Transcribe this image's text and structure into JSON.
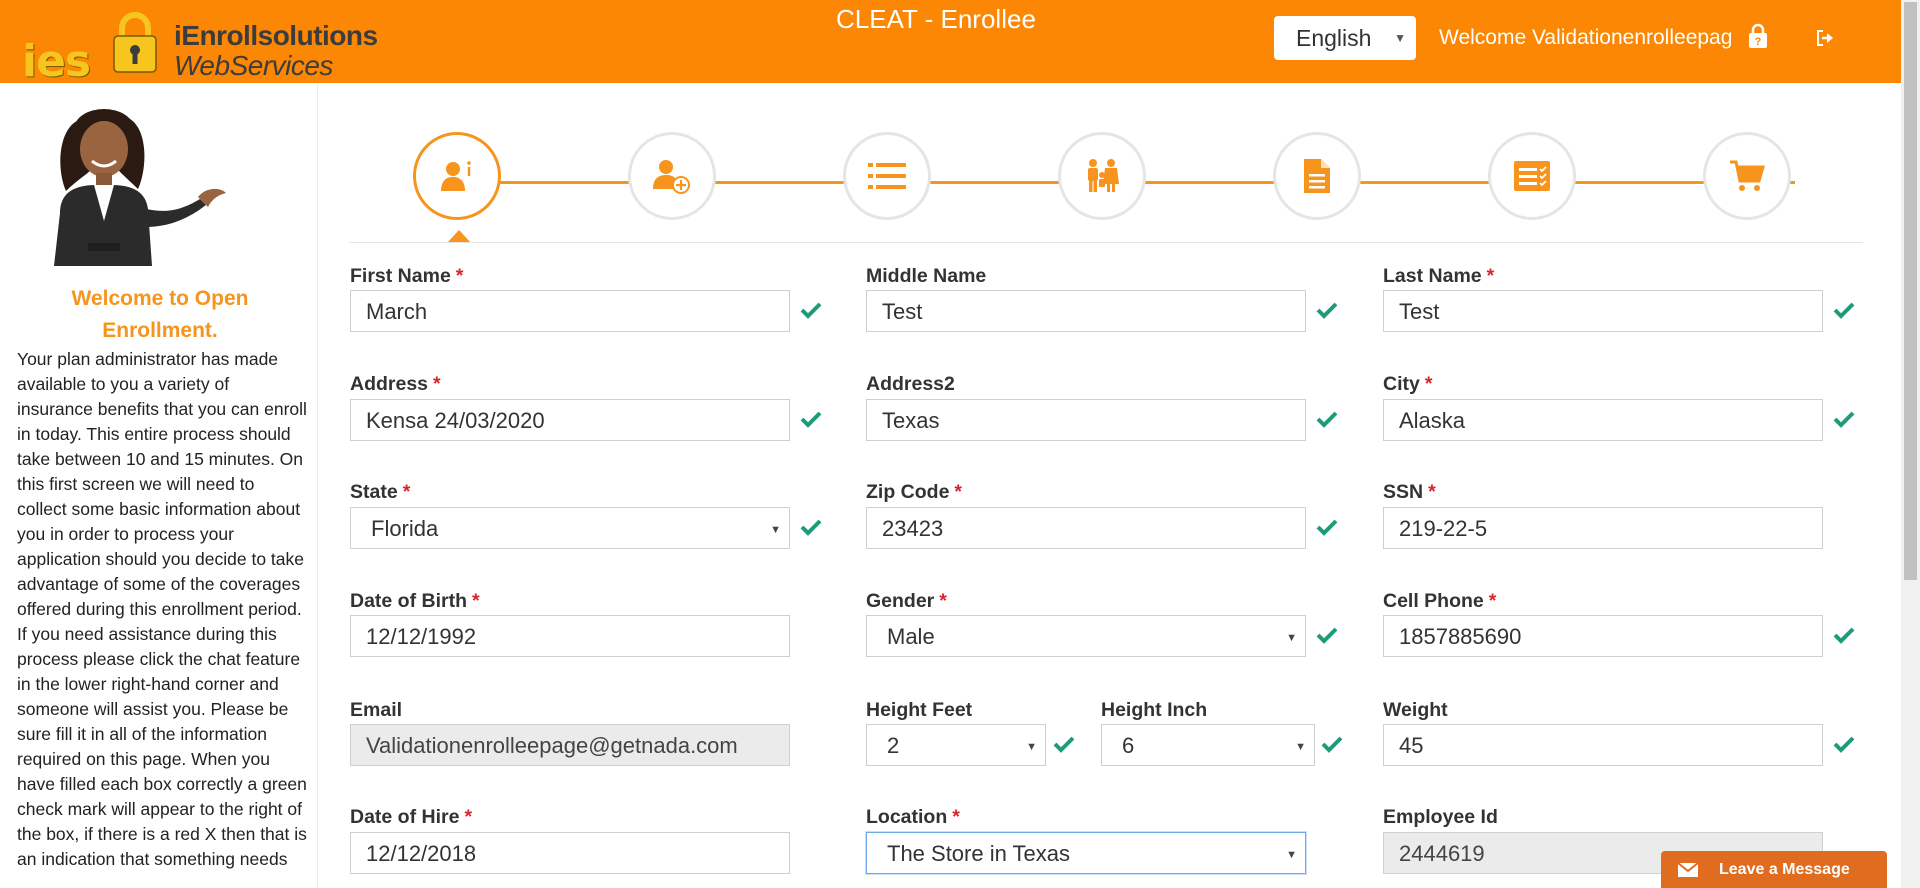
{
  "header": {
    "logo_abbrev": "ies",
    "logo_line1": "iEnrollsolutions",
    "logo_line2": "WebServices",
    "title": "CLEAT - Enrollee",
    "language": "English",
    "welcome": "Welcome Validationenrolleepag"
  },
  "sidebar": {
    "heading": "Welcome to Open Enrollment.",
    "body": "Your plan administrator has made available to you a variety of insurance benefits that you can enroll in today. This entire process should take between 10 and 15 minutes. On this first screen we will need to collect some basic information about you in order to process your application should you decide to take advantage of some of the coverages offered during this enrollment period.  If you need assistance during this process please click the chat feature in the lower right-hand corner and someone will assist you. Please be sure fill it in all of the information required on this page.  When you have filled each box correctly a green check mark will appear to the right of the box, if there is a red X then that is an indication that something needs"
  },
  "steps": [
    {
      "icon": "personal-info-icon",
      "active": true
    },
    {
      "icon": "add-dependent-icon",
      "active": false
    },
    {
      "icon": "list-icon",
      "active": false
    },
    {
      "icon": "family-icon",
      "active": false
    },
    {
      "icon": "document-icon",
      "active": false
    },
    {
      "icon": "checklist-icon",
      "active": false
    },
    {
      "icon": "cart-icon",
      "active": false
    }
  ],
  "form": {
    "first_name": {
      "label": "First Name",
      "value": "March"
    },
    "middle_name": {
      "label": "Middle Name",
      "value": "Test"
    },
    "last_name": {
      "label": "Last Name",
      "value": "Test"
    },
    "address": {
      "label": "Address",
      "value": "Kensa 24/03/2020"
    },
    "address2": {
      "label": "Address2",
      "value": "Texas"
    },
    "city": {
      "label": "City",
      "value": "Alaska"
    },
    "state": {
      "label": "State",
      "value": "Florida"
    },
    "zip": {
      "label": "Zip Code",
      "value": "23423"
    },
    "ssn": {
      "label": "SSN",
      "value": "219-22-5"
    },
    "dob": {
      "label": "Date of Birth",
      "value": "12/12/1992"
    },
    "gender": {
      "label": "Gender",
      "value": "Male"
    },
    "cell": {
      "label": "Cell Phone",
      "value": "1857885690"
    },
    "email": {
      "label": "Email",
      "value": "Validationenrolleepage@getnada.com"
    },
    "height_feet": {
      "label": "Height Feet",
      "value": "2"
    },
    "height_inch": {
      "label": "Height Inch",
      "value": "6"
    },
    "weight": {
      "label": "Weight",
      "value": "45"
    },
    "hire_date": {
      "label": "Date of Hire",
      "value": "12/12/2018"
    },
    "location": {
      "label": "Location",
      "value": "The Store in Texas"
    },
    "employee_id": {
      "label": "Employee Id",
      "value": "2444619"
    }
  },
  "chat": {
    "label": "Leave a Message"
  },
  "colors": {
    "accent": "#fb8704",
    "check": "#1e9c7a",
    "required": "#d9232e"
  }
}
